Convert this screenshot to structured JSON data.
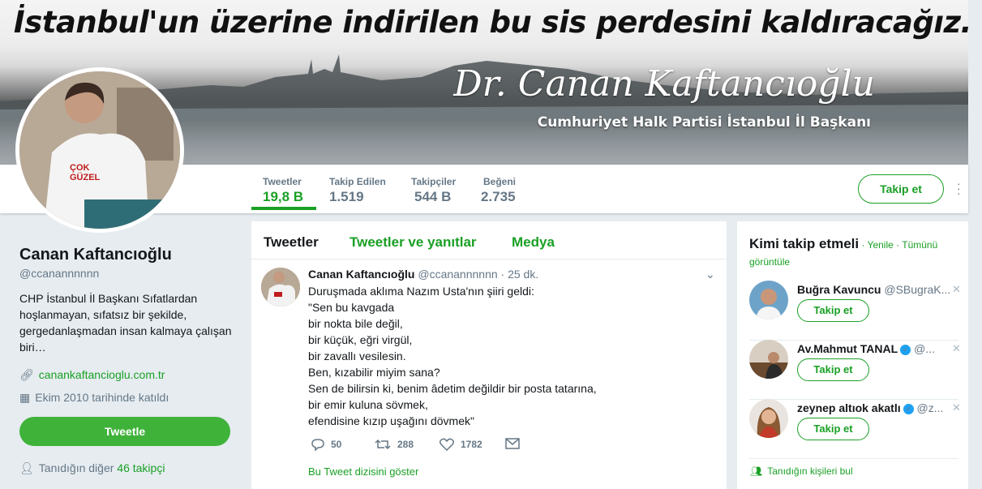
{
  "banner": {
    "headline": "İstanbul'un üzerine indirilen bu sis perdesini kaldıracağız.",
    "signature": "Dr. Canan Kaftancıoğlu",
    "subtitle": "Cumhuriyet Halk Partisi İstanbul İl Başkanı"
  },
  "stats": [
    {
      "label": "Tweetler",
      "value": "19,8 B"
    },
    {
      "label": "Takip Edilen",
      "value": "1.519"
    },
    {
      "label": "Takipçiler",
      "value": "544 B"
    },
    {
      "label": "Beğeni",
      "value": "2.735"
    }
  ],
  "follow_label": "Takip et",
  "profile": {
    "name": "Canan Kaftancıoğlu",
    "handle": "@ccanannnnnn",
    "bio": "CHP İstanbul İl Başkanı Sıfatlardan hoşlanmayan, sıfatsız bir şekilde, gergedanlaşmadan insan kalmaya çalışan biri…",
    "website": "canankaftancioglu.com.tr",
    "joined": "Ekim 2010 tarihinde katıldı",
    "tweet_button": "Tweetle",
    "known_followers_prefix": "Tanıdığın diğer",
    "known_followers_count": "46 takipçi"
  },
  "timeline": {
    "tabs": [
      "Tweetler",
      "Tweetler ve yanıtlar",
      "Medya"
    ],
    "tweet": {
      "author": "Canan Kaftancıoğlu",
      "handle": "@ccanannnnnn",
      "time": "· 25 dk.",
      "text": "Duruşmada aklıma Nazım Usta'nın şiiri geldi:\n\"Sen bu kavgada\nbir nokta bile değil,\nbir küçük, eğri virgül,\nbir zavallı vesilesin.\nBen, kızabilir miyim sana?\nSen de bilirsin ki, benim âdetim değildir bir posta tatarına,\nbir emir kuluna sövmek,\nefendisine kızıp uşağını dövmek\"",
      "replies": "50",
      "retweets": "288",
      "likes": "1782",
      "thread_link": "Bu Tweet dizisini göster"
    }
  },
  "who_to_follow": {
    "title": "Kimi takip etmeli",
    "refresh": " · Yenile",
    "view_all": " · Tümünü görüntüle",
    "items": [
      {
        "name": "Buğra Kavuncu",
        "handle": "@SBugraK...",
        "verified": false
      },
      {
        "name": "Av.Mahmut TANAL",
        "handle": "@...",
        "verified": true
      },
      {
        "name": "zeynep altıok akatlı",
        "handle": "@z...",
        "verified": true
      }
    ],
    "follow_label": "Takip et",
    "find_friends": "Tanıdığın kişileri bul"
  }
}
